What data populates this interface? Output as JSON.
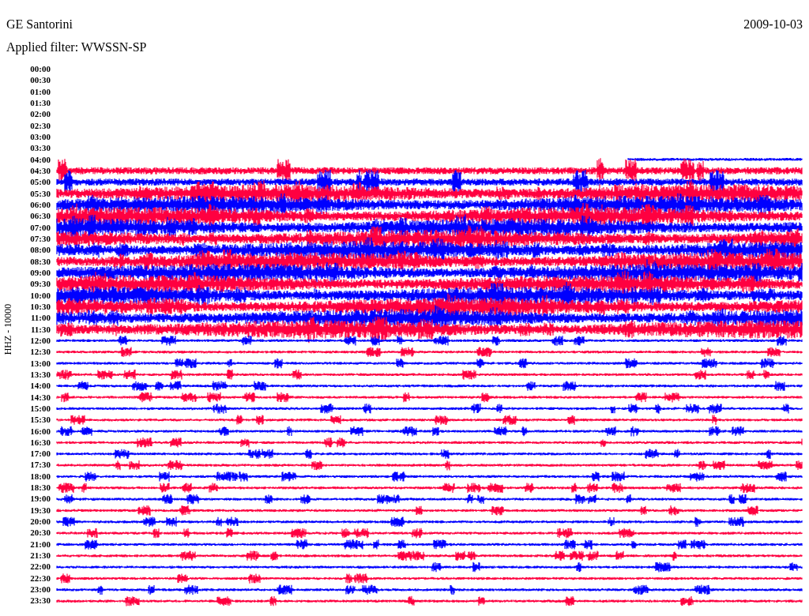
{
  "header": {
    "station": "GE Santorini",
    "filter": "Applied filter: WWSSN-SP",
    "date": "2009-10-03"
  },
  "axis_label": "HHZ - 10000",
  "traces": [
    {
      "time": "00:00",
      "kind": "empty"
    },
    {
      "time": "00:30",
      "kind": "empty"
    },
    {
      "time": "01:00",
      "kind": "empty"
    },
    {
      "time": "01:30",
      "kind": "empty"
    },
    {
      "time": "02:00",
      "kind": "empty"
    },
    {
      "time": "02:30",
      "kind": "empty"
    },
    {
      "time": "03:00",
      "kind": "empty"
    },
    {
      "time": "03:30",
      "kind": "empty"
    },
    {
      "time": "04:00",
      "kind": "partial",
      "color": "#0000ff"
    },
    {
      "time": "04:30",
      "kind": "medium",
      "color": "#ff0040"
    },
    {
      "time": "05:00",
      "kind": "medium",
      "color": "#0000ff"
    },
    {
      "time": "05:30",
      "kind": "heavy",
      "color": "#ff0040"
    },
    {
      "time": "06:00",
      "kind": "heavy",
      "color": "#0000ff"
    },
    {
      "time": "06:30",
      "kind": "heavy",
      "color": "#ff0040"
    },
    {
      "time": "07:00",
      "kind": "heavy",
      "color": "#0000ff"
    },
    {
      "time": "07:30",
      "kind": "heavy",
      "color": "#ff0040"
    },
    {
      "time": "08:00",
      "kind": "heavy",
      "color": "#0000ff"
    },
    {
      "time": "08:30",
      "kind": "heavy",
      "color": "#ff0040"
    },
    {
      "time": "09:00",
      "kind": "heavy",
      "color": "#0000ff"
    },
    {
      "time": "09:30",
      "kind": "heavy",
      "color": "#ff0040"
    },
    {
      "time": "10:00",
      "kind": "heavy",
      "color": "#0000ff"
    },
    {
      "time": "10:30",
      "kind": "heavy",
      "color": "#ff0040"
    },
    {
      "time": "11:00",
      "kind": "heavy",
      "color": "#0000ff"
    },
    {
      "time": "11:30",
      "kind": "heavy",
      "color": "#ff0040"
    },
    {
      "time": "12:00",
      "kind": "quiet",
      "color": "#0000ff"
    },
    {
      "time": "12:30",
      "kind": "quiet",
      "color": "#ff0040"
    },
    {
      "time": "13:00",
      "kind": "quiet",
      "color": "#0000ff"
    },
    {
      "time": "13:30",
      "kind": "quiet",
      "color": "#ff0040"
    },
    {
      "time": "14:00",
      "kind": "quiet",
      "color": "#0000ff"
    },
    {
      "time": "14:30",
      "kind": "quiet",
      "color": "#ff0040"
    },
    {
      "time": "15:00",
      "kind": "quiet",
      "color": "#0000ff"
    },
    {
      "time": "15:30",
      "kind": "quiet",
      "color": "#ff0040"
    },
    {
      "time": "16:00",
      "kind": "quiet",
      "color": "#0000ff"
    },
    {
      "time": "16:30",
      "kind": "quiet",
      "color": "#ff0040"
    },
    {
      "time": "17:00",
      "kind": "quiet",
      "color": "#0000ff"
    },
    {
      "time": "17:30",
      "kind": "quiet",
      "color": "#ff0040"
    },
    {
      "time": "18:00",
      "kind": "quiet",
      "color": "#0000ff"
    },
    {
      "time": "18:30",
      "kind": "quiet",
      "color": "#ff0040"
    },
    {
      "time": "19:00",
      "kind": "quiet",
      "color": "#0000ff"
    },
    {
      "time": "19:30",
      "kind": "quiet",
      "color": "#ff0040"
    },
    {
      "time": "20:00",
      "kind": "quiet",
      "color": "#0000ff"
    },
    {
      "time": "20:30",
      "kind": "quiet",
      "color": "#ff0040"
    },
    {
      "time": "21:00",
      "kind": "quiet",
      "color": "#0000ff"
    },
    {
      "time": "21:30",
      "kind": "quiet",
      "color": "#ff0040"
    },
    {
      "time": "22:00",
      "kind": "quiet",
      "color": "#0000ff"
    },
    {
      "time": "22:30",
      "kind": "quiet",
      "color": "#ff0040"
    },
    {
      "time": "23:00",
      "kind": "quiet",
      "color": "#0000ff"
    },
    {
      "time": "23:30",
      "kind": "quiet",
      "color": "#ff0040"
    }
  ]
}
